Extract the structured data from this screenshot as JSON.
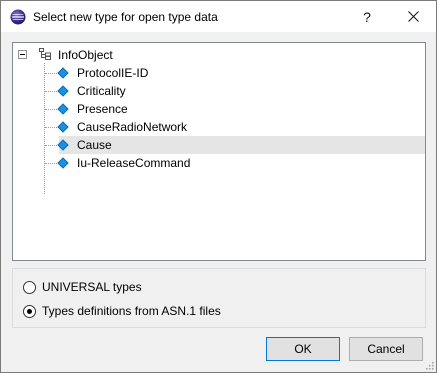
{
  "window": {
    "title": "Select new type for open type data",
    "help_glyph": "?",
    "close_glyph": "✕"
  },
  "tree": {
    "root": {
      "label": "InfoObject",
      "icon": "structure-icon",
      "expanded": true
    },
    "items": [
      {
        "label": "ProtocolIE-ID",
        "icon": "diamond-icon",
        "selected": false
      },
      {
        "label": "Criticality",
        "icon": "diamond-icon",
        "selected": false
      },
      {
        "label": "Presence",
        "icon": "diamond-icon",
        "selected": false
      },
      {
        "label": "CauseRadioNetwork",
        "icon": "diamond-icon",
        "selected": false
      },
      {
        "label": "Cause",
        "icon": "diamond-icon",
        "selected": true
      },
      {
        "label": "Iu-ReleaseCommand",
        "icon": "diamond-icon",
        "selected": false
      }
    ]
  },
  "options": {
    "universal_label": "UNIVERSAL types",
    "universal_checked": false,
    "asn_label": "Types definitions from ASN.1 files",
    "asn_checked": true
  },
  "buttons": {
    "ok_label": "OK",
    "cancel_label": "Cancel"
  },
  "colors": {
    "leaf_icon": "#1e90e0",
    "selection": "#e5e5e5",
    "default_button_border": "#0078d7"
  }
}
